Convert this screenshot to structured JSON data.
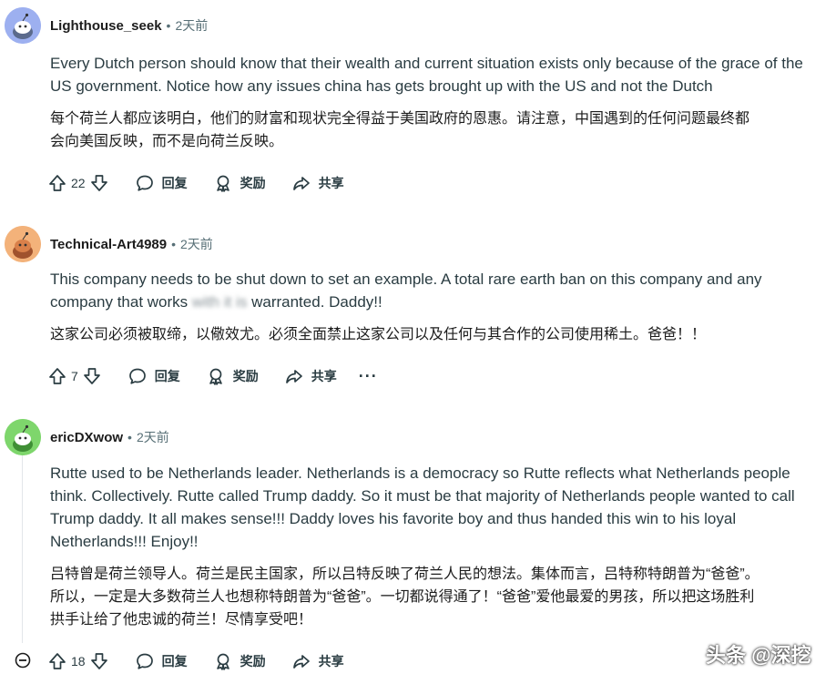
{
  "comments": [
    {
      "username": "Lighthouse_seek",
      "separator": "•",
      "time": "2天前",
      "avatar_color": "#9db0f0",
      "text_en": [
        "Every Dutch person should know that their wealth and current situation exists only because of the grace of the",
        "US government. Notice how any issues china has gets brought up with the US and not the Dutch"
      ],
      "text_zh": [
        "每个荷兰人都应该明白，他们的财富和现状完全得益于美国政府的恩惠。请注意，中国遇到的任何问题最终都",
        "会向美国反映，而不是向荷兰反映。"
      ],
      "votes": "22",
      "reply_label": "回复",
      "award_label": "奖励",
      "share_label": "共享"
    },
    {
      "username": "Technical-Art4989",
      "separator": "•",
      "time": "2天前",
      "avatar_color": "#f3b27a",
      "text_en": [
        "This company needs to be shut down to set an example. A total rare earth ban on this company and any",
        "company that works "
      ],
      "text_en_blurred": "with it is",
      "text_en_tail": " warranted. Daddy!!",
      "text_zh": [
        "这家公司必须被取缔，以儆效尤。必须全面禁止这家公司以及任何与其合作的公司使用稀土。爸爸！！"
      ],
      "votes": "7",
      "reply_label": "回复",
      "award_label": "奖励",
      "share_label": "共享",
      "more_label": "···"
    },
    {
      "username": "ericDXwow",
      "separator": "•",
      "time": "2天前",
      "avatar_color": "#7ed66c",
      "text_en": [
        "Rutte used to be Netherlands leader. Netherlands is a democracy so Rutte reflects what Netherlands people",
        "think. Collectively. Rutte called Trump daddy. So it must be that majority of Netherlands people wanted to call",
        "Trump daddy. It all makes sense!!! Daddy loves his favorite boy and thus handed this win to his loyal",
        "Netherlands!!! Enjoy!!"
      ],
      "text_zh": [
        "吕特曾是荷兰领导人。荷兰是民主国家，所以吕特反映了荷兰人民的想法。集体而言，吕特称特朗普为“爸爸”。",
        "所以，一定是大多数荷兰人也想称特朗普为“爸爸”。一切都说得通了！“爸爸”爱他最爱的男孩，所以把这场胜利",
        "拱手让给了他忠诚的荷兰！尽情享受吧！"
      ],
      "votes": "18",
      "reply_label": "回复",
      "award_label": "奖励",
      "share_label": "共享"
    }
  ],
  "watermark": "头条 @深挖",
  "icons": {
    "upvote": "arrow-up-icon",
    "downvote": "arrow-down-icon",
    "reply": "speech-bubble-icon",
    "award": "award-ribbon-icon",
    "share": "share-arrow-icon",
    "collapse": "collapse-minus-icon"
  },
  "colors": {
    "text_primary": "#1c1c1c",
    "text_secondary": "#576f76",
    "thread_line": "#e2e6e9"
  }
}
